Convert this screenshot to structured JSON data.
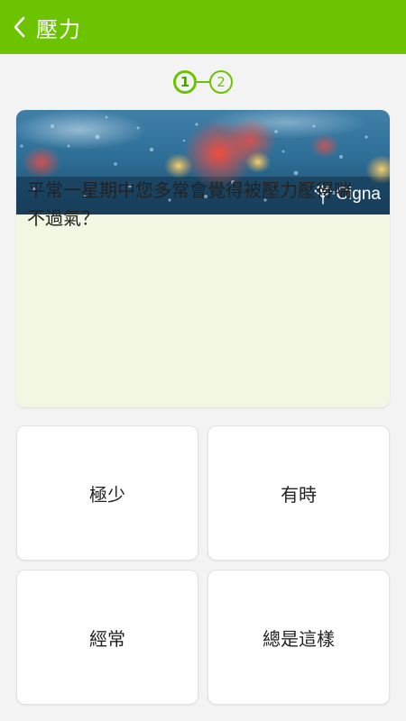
{
  "header": {
    "title": "壓力",
    "color": "#6cc400"
  },
  "stepper": {
    "steps": [
      "1",
      "2"
    ],
    "current": "1"
  },
  "card": {
    "brand": "Cigna",
    "question": "平常一星期中您多常會覺得被壓力壓得喘不過氣？"
  },
  "options": [
    {
      "label": "極少"
    },
    {
      "label": "有時"
    },
    {
      "label": "經常"
    },
    {
      "label": "總是這樣"
    }
  ],
  "icons": {
    "back": "back-arrow-icon",
    "brand": "cigna-tree-logo-icon"
  }
}
